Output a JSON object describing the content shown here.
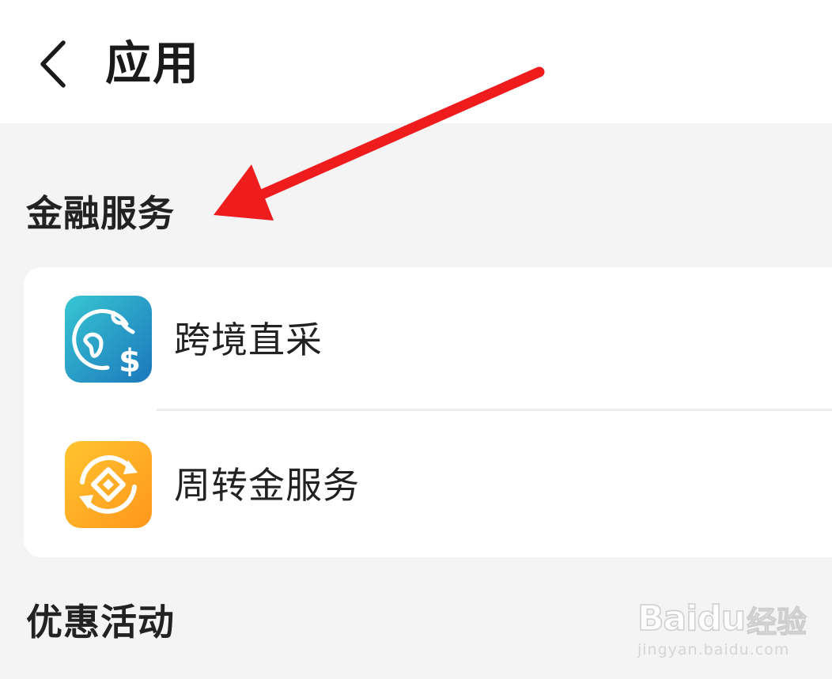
{
  "header": {
    "title": "应用",
    "back_icon": "chevron-left-icon"
  },
  "sections": [
    {
      "title": "金融服务",
      "items": [
        {
          "label": "跨境直采",
          "icon": "globe-dollar-icon",
          "icon_colors": [
            "#34c3d0",
            "#1e7fbf"
          ]
        },
        {
          "label": "周转金服务",
          "icon": "exchange-coin-icon",
          "icon_colors": [
            "#ffc22e",
            "#ff9a1f"
          ]
        }
      ]
    },
    {
      "title": "优惠活动",
      "items": []
    }
  ],
  "annotation": {
    "arrow_color": "#ee1c1c"
  },
  "watermark": {
    "brand": "Baidu",
    "cn": "经验",
    "url": "jingyan.baidu.com"
  }
}
